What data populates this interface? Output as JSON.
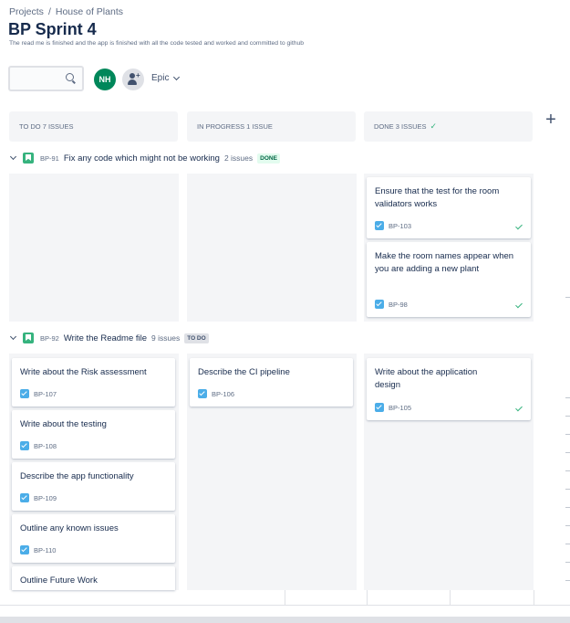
{
  "breadcrumb": {
    "projects": "Projects",
    "separator": "/",
    "project": "House of Plants"
  },
  "sprint": {
    "title": "BP Sprint 4",
    "goal": "The read me is finished and the app is finished with all the code tested and worked and committed to github"
  },
  "filters": {
    "search_placeholder": "",
    "avatar_initials": "NH",
    "epic_label": "Epic"
  },
  "columns": [
    {
      "name": "TO DO 7 ISSUES"
    },
    {
      "name": "IN PROGRESS 1 ISSUE"
    },
    {
      "name": "DONE 3 ISSUES"
    }
  ],
  "add_column": "+",
  "swimlanes": [
    {
      "key": "BP-91",
      "summary": "Fix any code which might not be working",
      "count": "2 issues",
      "status": "DONE"
    },
    {
      "key": "BP-92",
      "summary": "Write the Readme file",
      "count": "9 issues",
      "status": "TO DO"
    }
  ],
  "cards": {
    "bp103": {
      "summary": "Ensure that the test for the room validators works",
      "key": "BP-103"
    },
    "bp98": {
      "summary": "Make the room names appear when you are adding a new plant",
      "key": "BP-98"
    },
    "bp107": {
      "summary": "Write about the Risk assessment",
      "key": "BP-107"
    },
    "bp108": {
      "summary": "Write about the testing",
      "key": "BP-108"
    },
    "bp109": {
      "summary": "Describe the app functionality",
      "key": "BP-109"
    },
    "bp110": {
      "summary": "Outline any known issues",
      "key": "BP-110"
    },
    "future": {
      "summary": "Outline Future Work"
    },
    "bp106": {
      "summary": "Describe the CI pipeline",
      "key": "BP-106"
    },
    "bp105": {
      "summary": "Write about the application design",
      "key": "BP-105"
    }
  },
  "colors": {
    "done_green": "#36b37e",
    "story_green": "#36b37e",
    "task_blue": "#4bade8",
    "avatar_green": "#00875a"
  }
}
